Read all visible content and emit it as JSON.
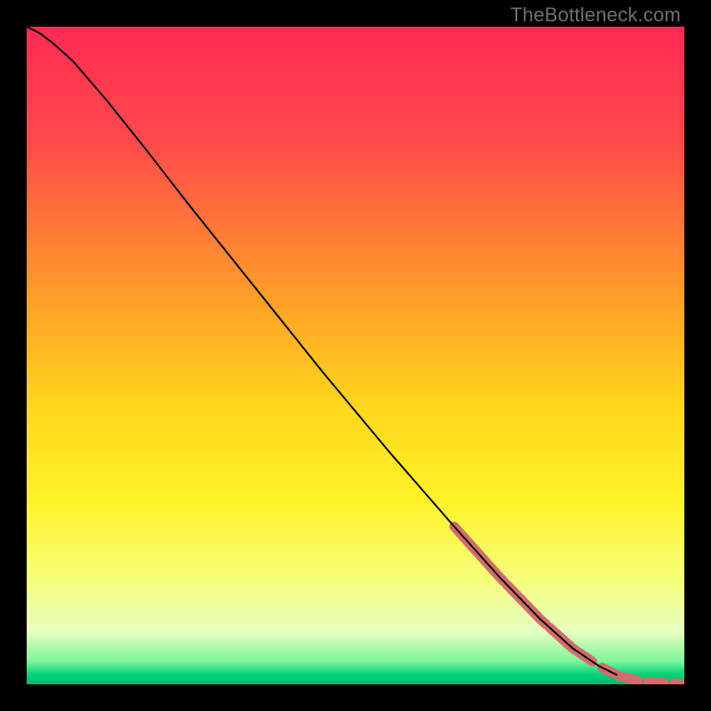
{
  "watermark": "TheBottleneck.com",
  "chart_data": {
    "type": "line",
    "title": "",
    "xlabel": "",
    "ylabel": "",
    "xlim": [
      0,
      100
    ],
    "ylim": [
      0,
      100
    ],
    "grid": false,
    "legend": false,
    "background_gradient": {
      "stops": [
        {
          "offset": 0.0,
          "color": "#ff2a55"
        },
        {
          "offset": 0.18,
          "color": "#ff4b4a"
        },
        {
          "offset": 0.4,
          "color": "#ff9a2a"
        },
        {
          "offset": 0.58,
          "color": "#ffd71c"
        },
        {
          "offset": 0.72,
          "color": "#fff228"
        },
        {
          "offset": 0.84,
          "color": "#f6ff7a"
        },
        {
          "offset": 0.92,
          "color": "#e7ffc3"
        },
        {
          "offset": 0.965,
          "color": "#7df59a"
        },
        {
          "offset": 0.985,
          "color": "#00d27a"
        },
        {
          "offset": 1.0,
          "color": "#00b86b"
        }
      ]
    },
    "series": [
      {
        "name": "curve",
        "stroke": "#000000",
        "stroke_width": 2,
        "points": [
          {
            "x": 0.0,
            "y": 100.0
          },
          {
            "x": 2.0,
            "y": 99.0
          },
          {
            "x": 4.0,
            "y": 97.5
          },
          {
            "x": 7.0,
            "y": 94.8
          },
          {
            "x": 12.0,
            "y": 89.0
          },
          {
            "x": 18.0,
            "y": 81.5
          },
          {
            "x": 25.0,
            "y": 72.5
          },
          {
            "x": 35.0,
            "y": 60.0
          },
          {
            "x": 45.0,
            "y": 47.5
          },
          {
            "x": 55.0,
            "y": 35.5
          },
          {
            "x": 65.0,
            "y": 24.0
          },
          {
            "x": 72.0,
            "y": 16.2
          },
          {
            "x": 78.0,
            "y": 10.0
          },
          {
            "x": 83.0,
            "y": 5.5
          },
          {
            "x": 87.0,
            "y": 2.8
          },
          {
            "x": 90.0,
            "y": 1.3
          },
          {
            "x": 93.0,
            "y": 0.6
          },
          {
            "x": 96.0,
            "y": 0.25
          },
          {
            "x": 100.0,
            "y": 0.1
          }
        ]
      }
    ],
    "highlighted_segments": {
      "color": "#d36c6c",
      "stroke_width": 11,
      "segments": [
        {
          "x_start": 65.0,
          "x_end": 72.5
        },
        {
          "x_start": 73.0,
          "x_end": 79.0
        },
        {
          "x_start": 79.5,
          "x_end": 83.5
        },
        {
          "x_start": 84.0,
          "x_end": 86.0
        },
        {
          "x_start": 87.5,
          "x_end": 90.0
        }
      ]
    },
    "highlighted_tail_dashes": {
      "color": "#d36c6c",
      "stroke_width": 11,
      "segments": [
        {
          "x_start": 90.5,
          "x_end": 93.0
        },
        {
          "x_start": 94.5,
          "x_end": 97.0
        },
        {
          "x_start": 98.5,
          "x_end": 100.0
        }
      ]
    }
  }
}
